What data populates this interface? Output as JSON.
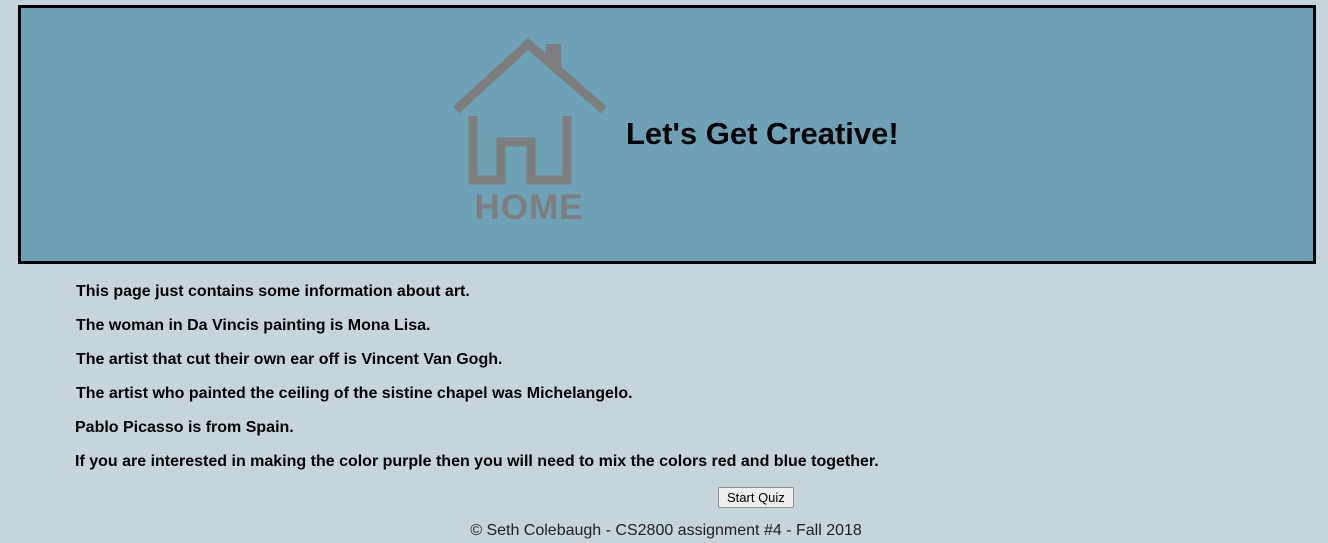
{
  "header": {
    "logo_icon": "home-icon",
    "logo_text": "HOME",
    "title": "Let's Get Creative!",
    "background": "#6ca2b4"
  },
  "content": {
    "facts": [
      "This page just contains some information about art.",
      "The woman in Da Vincis painting is Mona Lisa.",
      "The artist that cut their own ear off is Vincent Van Gogh.",
      "The artist who painted the ceiling of the sistine chapel was Michelangelo.",
      "Pablo Picasso is from Spain.",
      "If you are interested in making the color purple then you will need to mix the colors red and blue together."
    ]
  },
  "quiz": {
    "button_label": "Start Quiz"
  },
  "footer": {
    "text": "© Seth Colebaugh - CS2800 assignment #4 - Fall 2018"
  },
  "colors": {
    "page_background": "#c6d4db",
    "logo_gray": "#7d7d7d"
  }
}
